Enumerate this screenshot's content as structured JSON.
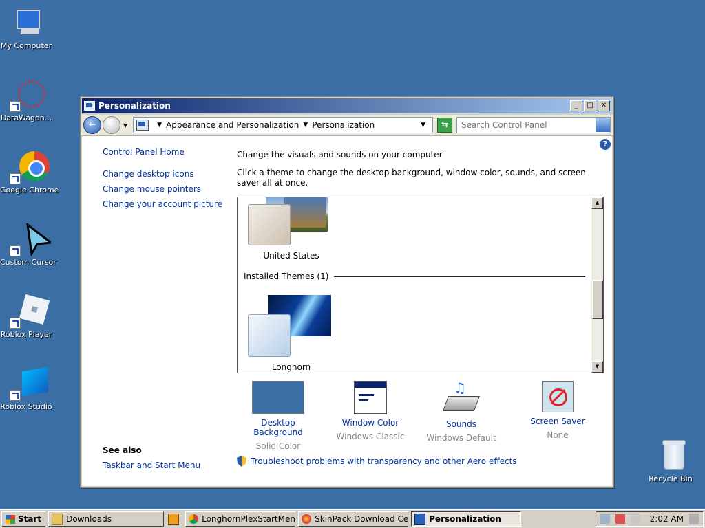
{
  "desktop": {
    "icons": [
      {
        "label": "My Computer"
      },
      {
        "label": "DataWagon..."
      },
      {
        "label": "Google Chrome"
      },
      {
        "label": "Custom Cursor"
      },
      {
        "label": "Roblox Player"
      },
      {
        "label": "Roblox Studio"
      },
      {
        "label": "Recycle Bin"
      }
    ]
  },
  "window": {
    "title": "Personalization",
    "address": {
      "crumbs": [
        "Appearance and Personalization",
        "Personalization"
      ]
    },
    "search": {
      "placeholder": "Search Control Panel"
    },
    "nav": {
      "home": "Control Panel Home",
      "links": [
        "Change desktop icons",
        "Change mouse pointers",
        "Change your account picture"
      ]
    },
    "see_also": {
      "heading": "See also",
      "link": "Taskbar and Start Menu"
    },
    "main": {
      "heading": "Change the visuals and sounds on your computer",
      "subtext": "Click a theme to change the desktop background, window color, sounds, and screen saver all at once.",
      "themes": [
        {
          "name": "United States"
        },
        {
          "name": "Longhorn"
        }
      ],
      "installed_label": "Installed Themes (1)"
    },
    "tiles": [
      {
        "name": "Desktop Background",
        "value": "Solid Color"
      },
      {
        "name": "Window Color",
        "value": "Windows Classic"
      },
      {
        "name": "Sounds",
        "value": "Windows Default"
      },
      {
        "name": "Screen Saver",
        "value": "None"
      }
    ],
    "troubleshoot": "Troubleshoot problems with transparency and other Aero effects"
  },
  "taskbar": {
    "start": "Start",
    "items": [
      {
        "label": "Downloads"
      },
      {
        "label": "LonghornPlexStartMenu ..."
      },
      {
        "label": "SkinPack Download Cent..."
      },
      {
        "label": "Personalization"
      }
    ],
    "clock": "2:02 AM"
  }
}
